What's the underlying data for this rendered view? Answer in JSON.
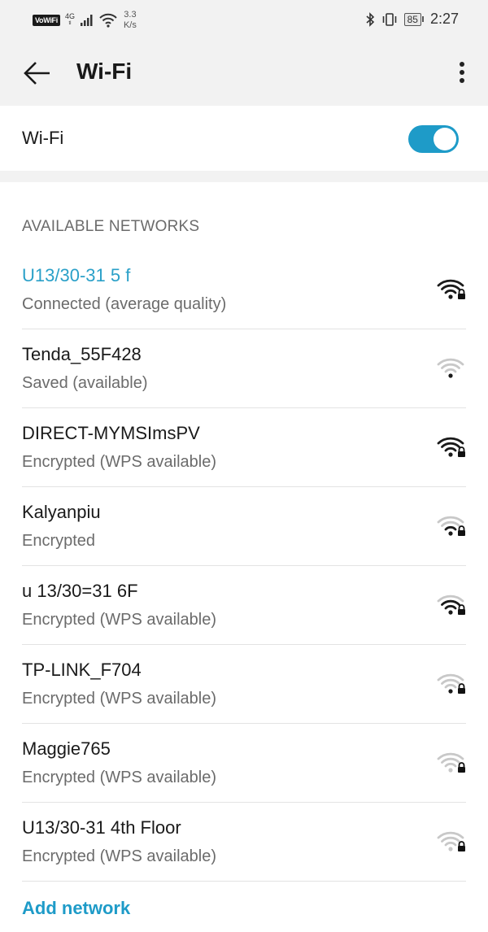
{
  "status_bar": {
    "volte": "VoWiFi",
    "network_gen": "4G",
    "network_sub": "tl",
    "speed_value": "3.3",
    "speed_unit": "K/s",
    "battery": "85",
    "time": "2:27"
  },
  "appbar": {
    "title": "Wi-Fi"
  },
  "wifi_toggle": {
    "label": "Wi-Fi",
    "on": true
  },
  "section": {
    "header": "AVAILABLE NETWORKS"
  },
  "networks": [
    {
      "name": "U13/30-31 5 f",
      "status": "Connected (average quality)",
      "strength": 4,
      "locked": true,
      "connected": true
    },
    {
      "name": "Tenda_55F428",
      "status": "Saved (available)",
      "strength": 1,
      "locked": false,
      "connected": false
    },
    {
      "name": "DIRECT-MYMSImsPV",
      "status": "Encrypted (WPS available)",
      "strength": 4,
      "locked": true,
      "connected": false
    },
    {
      "name": "Kalyanpiu",
      "status": "Encrypted",
      "strength": 2,
      "locked": true,
      "connected": false
    },
    {
      "name": "u 13/30=31 6F",
      "status": "Encrypted (WPS available)",
      "strength": 3,
      "locked": true,
      "connected": false
    },
    {
      "name": "TP-LINK_F704",
      "status": "Encrypted (WPS available)",
      "strength": 1,
      "locked": true,
      "connected": false
    },
    {
      "name": "Maggie765",
      "status": "Encrypted (WPS available)",
      "strength": 0,
      "locked": true,
      "connected": false
    },
    {
      "name": "U13/30-31 4th Floor",
      "status": "Encrypted (WPS available)",
      "strength": 0,
      "locked": true,
      "connected": false
    }
  ],
  "add_network": "Add network",
  "colors": {
    "accent": "#1e9bc8",
    "connected_text": "#2aa0c8",
    "secondary_text": "#6b6b6b",
    "background_gray": "#f2f2f2"
  },
  "icons": {
    "back": "arrow-left-icon",
    "more": "more-vert-icon",
    "wifi": "wifi-signal-icon",
    "lock": "lock-icon"
  }
}
